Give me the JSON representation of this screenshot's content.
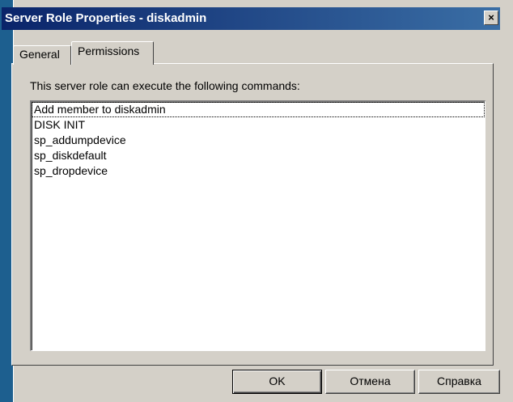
{
  "window": {
    "title": "Server Role Properties - diskadmin",
    "close_glyph": "×"
  },
  "tabs": [
    {
      "label": "General",
      "selected": false
    },
    {
      "label": "Permissions",
      "selected": true
    }
  ],
  "permissions": {
    "description": "This server role can execute the following commands:",
    "commands": [
      "Add member to diskadmin",
      "DISK INIT",
      "sp_addumpdevice",
      "sp_diskdefault",
      "sp_dropdevice"
    ],
    "focused_index": 0
  },
  "buttons": {
    "ok": "OK",
    "cancel": "Отмена",
    "help": "Справка"
  },
  "colors": {
    "titlebar": "#0a246a",
    "face": "#d4d0c8",
    "desktop": "#1d5f8f"
  }
}
